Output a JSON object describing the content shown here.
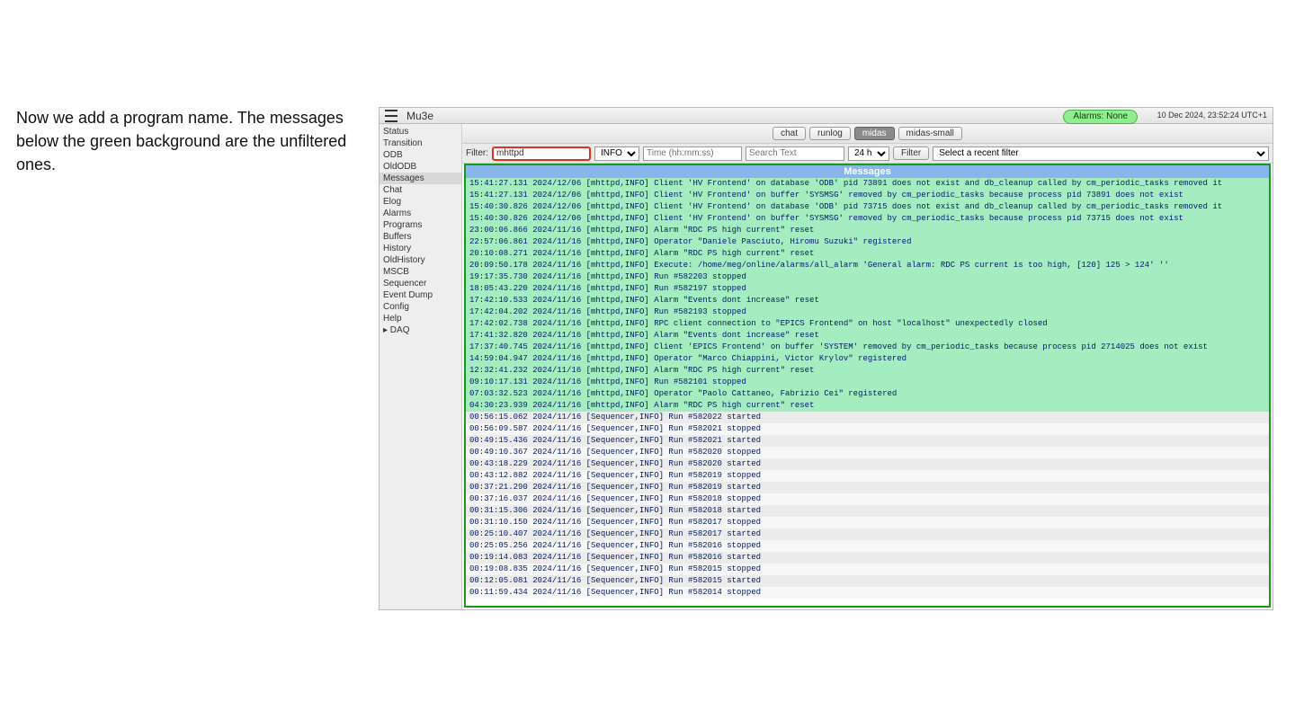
{
  "caption": "Now we add a program name. The messages below the green background are the unfiltered ones.",
  "app": {
    "title": "Mu3e",
    "alarms_label": "Alarms: None",
    "clock": "10 Dec 2024, 23:52:24 UTC+1"
  },
  "sidebar": {
    "items": [
      {
        "label": "Status",
        "selected": false
      },
      {
        "label": "Transition",
        "selected": false
      },
      {
        "label": "ODB",
        "selected": false
      },
      {
        "label": "OldODB",
        "selected": false
      },
      {
        "label": "Messages",
        "selected": true
      },
      {
        "label": "Chat",
        "selected": false
      },
      {
        "label": "Elog",
        "selected": false
      },
      {
        "label": "Alarms",
        "selected": false
      },
      {
        "label": "Programs",
        "selected": false
      },
      {
        "label": "Buffers",
        "selected": false
      },
      {
        "label": "History",
        "selected": false
      },
      {
        "label": "OldHistory",
        "selected": false
      },
      {
        "label": "MSCB",
        "selected": false
      },
      {
        "label": "Sequencer",
        "selected": false
      },
      {
        "label": "Event Dump",
        "selected": false
      },
      {
        "label": "Config",
        "selected": false
      },
      {
        "label": "Help",
        "selected": false
      }
    ],
    "expander_label": "▸ DAQ"
  },
  "topnav": {
    "chat": "chat",
    "runlog": "runlog",
    "midas": "midas",
    "midas_small": "midas-small"
  },
  "filterbar": {
    "label": "Filter:",
    "program_value": "mhttpd",
    "level_selected": "INFO",
    "time_placeholder": "Time (hh:mm:ss)",
    "search_placeholder": "Search Text",
    "range_selected": "24 h",
    "filter_button": "Filter",
    "recent_selected": "Select a recent filter"
  },
  "messages": {
    "header": "Messages",
    "rows": [
      {
        "m": true,
        "t": "15:41:27.131 2024/12/06 [mhttpd,INFO] Client 'HV Frontend' on database 'ODB' pid 73891 does not exist and db_cleanup called by cm_periodic_tasks removed it"
      },
      {
        "m": true,
        "t": "15:41:27.131 2024/12/06 [mhttpd,INFO] Client 'HV Frontend' on buffer 'SYSMSG' removed by cm_periodic_tasks because process pid 73891 does not exist"
      },
      {
        "m": true,
        "t": "15:40:30.826 2024/12/06 [mhttpd,INFO] Client 'HV Frontend' on database 'ODB' pid 73715 does not exist and db_cleanup called by cm_periodic_tasks removed it"
      },
      {
        "m": true,
        "t": "15:40:30.826 2024/12/06 [mhttpd,INFO] Client 'HV Frontend' on buffer 'SYSMSG' removed by cm_periodic_tasks because process pid 73715 does not exist"
      },
      {
        "m": true,
        "t": "23:00:06.866 2024/11/16 [mhttpd,INFO] Alarm \"RDC PS high current\" reset"
      },
      {
        "m": true,
        "t": "22:57:06.861 2024/11/16 [mhttpd,INFO] Operator \"Daniele Pasciuto, Hiromu Suzuki\" registered"
      },
      {
        "m": true,
        "t": "20:10:08.271 2024/11/16 [mhttpd,INFO] Alarm \"RDC PS high current\" reset"
      },
      {
        "m": true,
        "t": "20:09:50.178 2024/11/16 [mhttpd,INFO] Execute: /home/meg/online/alarms/all_alarm 'General alarm: RDC PS current is too high, [120] 125 > 124' ''"
      },
      {
        "m": true,
        "t": "19:17:35.730 2024/11/16 [mhttpd,INFO] Run #582203 stopped"
      },
      {
        "m": true,
        "t": "18:05:43.220 2024/11/16 [mhttpd,INFO] Run #582197 stopped"
      },
      {
        "m": true,
        "t": "17:42:10.533 2024/11/16 [mhttpd,INFO] Alarm \"Events dont increase\" reset"
      },
      {
        "m": true,
        "t": "17:42:04.202 2024/11/16 [mhttpd,INFO] Run #582193 stopped"
      },
      {
        "m": true,
        "t": "17:42:02.738 2024/11/16 [mhttpd,INFO] RPC client connection to \"EPICS Frontend\" on host \"localhost\" unexpectedly closed"
      },
      {
        "m": true,
        "t": "17:41:32.820 2024/11/16 [mhttpd,INFO] Alarm \"Events dont increase\" reset"
      },
      {
        "m": true,
        "t": "17:37:40.745 2024/11/16 [mhttpd,INFO] Client 'EPICS Frontend' on buffer 'SYSTEM' removed by cm_periodic_tasks because process pid 2714025 does not exist"
      },
      {
        "m": true,
        "t": "14:59:04.947 2024/11/16 [mhttpd,INFO] Operator \"Marco Chiappini, Victor Krylov\" registered"
      },
      {
        "m": true,
        "t": "12:32:41.232 2024/11/16 [mhttpd,INFO] Alarm \"RDC PS high current\" reset"
      },
      {
        "m": true,
        "t": "09:10:17.131 2024/11/16 [mhttpd,INFO] Run #582101 stopped"
      },
      {
        "m": true,
        "t": "07:03:32.523 2024/11/16 [mhttpd,INFO] Operator \"Paolo Cattaneo, Fabrizio Cei\" registered"
      },
      {
        "m": true,
        "t": "04:30:23.939 2024/11/16 [mhttpd,INFO] Alarm \"RDC PS high current\" reset"
      },
      {
        "m": false,
        "t": "00:56:15.062 2024/11/16 [Sequencer,INFO] Run #582022 started"
      },
      {
        "m": false,
        "t": "00:56:09.587 2024/11/16 [Sequencer,INFO] Run #582021 stopped"
      },
      {
        "m": false,
        "t": "00:49:15.436 2024/11/16 [Sequencer,INFO] Run #582021 started"
      },
      {
        "m": false,
        "t": "00:49:10.367 2024/11/16 [Sequencer,INFO] Run #582020 stopped"
      },
      {
        "m": false,
        "t": "00:43:18.229 2024/11/16 [Sequencer,INFO] Run #582020 started"
      },
      {
        "m": false,
        "t": "00:43:12.882 2024/11/16 [Sequencer,INFO] Run #582019 stopped"
      },
      {
        "m": false,
        "t": "00:37:21.290 2024/11/16 [Sequencer,INFO] Run #582019 started"
      },
      {
        "m": false,
        "t": "00:37:16.037 2024/11/16 [Sequencer,INFO] Run #582018 stopped"
      },
      {
        "m": false,
        "t": "00:31:15.306 2024/11/16 [Sequencer,INFO] Run #582018 started"
      },
      {
        "m": false,
        "t": "00:31:10.150 2024/11/16 [Sequencer,INFO] Run #582017 stopped"
      },
      {
        "m": false,
        "t": "00:25:10.407 2024/11/16 [Sequencer,INFO] Run #582017 started"
      },
      {
        "m": false,
        "t": "00:25:05.256 2024/11/16 [Sequencer,INFO] Run #582016 stopped"
      },
      {
        "m": false,
        "t": "00:19:14.083 2024/11/16 [Sequencer,INFO] Run #582016 started"
      },
      {
        "m": false,
        "t": "00:19:08.835 2024/11/16 [Sequencer,INFO] Run #582015 stopped"
      },
      {
        "m": false,
        "t": "00:12:05.081 2024/11/16 [Sequencer,INFO] Run #582015 started"
      },
      {
        "m": false,
        "t": "00:11:59.434 2024/11/16 [Sequencer,INFO] Run #582014 stopped"
      }
    ]
  }
}
